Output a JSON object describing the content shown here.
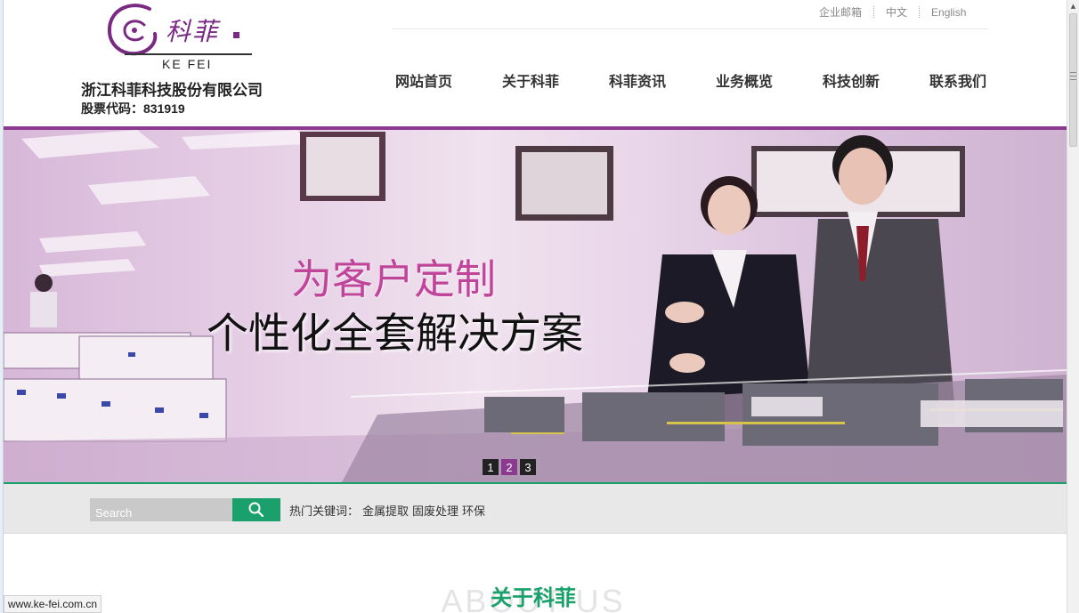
{
  "header": {
    "logo": {
      "cn": "科菲",
      "en": "KE FEI"
    },
    "company_name": "浙江科菲科技股份有限公司",
    "stock_code": "股票代码：831919"
  },
  "top_links": [
    "企业邮箱",
    "中文",
    "English"
  ],
  "nav": [
    "网站首页",
    "关于科菲",
    "科菲资讯",
    "业务概览",
    "科技创新",
    "联系我们"
  ],
  "banner": {
    "slogan_line1": "为客户定制",
    "slogan_line2": "个性化全套解决方案",
    "pager": [
      "1",
      "2",
      "3"
    ],
    "active_slide": 2
  },
  "search": {
    "placeholder": "Search",
    "hot_label": "热门关键词：",
    "hot_keywords": [
      "金属提取",
      "固废处理",
      "环保"
    ]
  },
  "about": {
    "title": "关于科菲",
    "bg_text": "ABOUT US"
  },
  "status_url": "www.ke-fei.com.cn",
  "colors": {
    "purple": "#8b3a8f",
    "green": "#1aa06a",
    "slogan_pink": "#c0449a"
  }
}
